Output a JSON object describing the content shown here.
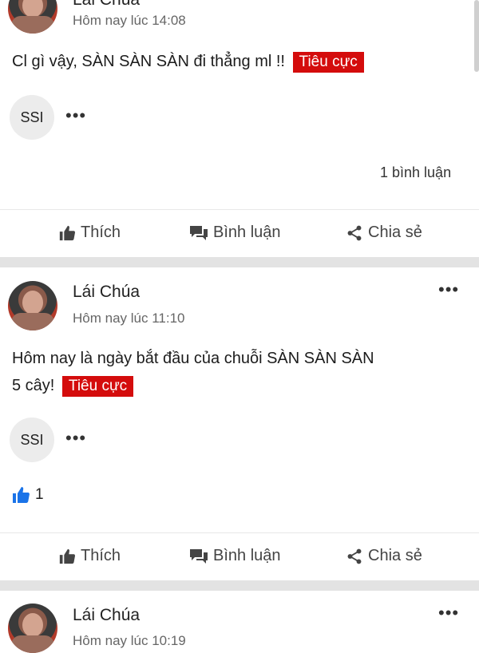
{
  "posts": [
    {
      "author": "Lái Chúa",
      "time": "Hôm nay lúc 14:08",
      "text": "Cl gì vậy, SÀN SÀN SÀN đi thẳng ml !!",
      "tag": "Tiêu cực",
      "chip": "SSI",
      "comment_count": "1 bình luận"
    },
    {
      "author": "Lái Chúa",
      "time": "Hôm nay lúc 11:10",
      "text_line1": "Hôm nay là ngày bắt đầu của chuỗi SÀN SÀN SÀN",
      "text_line2": "5 cây!",
      "tag": "Tiêu cực",
      "chip": "SSI",
      "like_count": "1"
    },
    {
      "author": "Lái Chúa",
      "time": "Hôm nay lúc 10:19"
    }
  ],
  "actions": {
    "like": "Thích",
    "comment": "Bình luận",
    "share": "Chia sẻ"
  },
  "icons": {
    "more": "more-horizontal-icon",
    "like": "thumbs-up-icon",
    "comment": "chat-bubbles-icon",
    "share": "share-icon"
  },
  "colors": {
    "tag_bg": "#d40c0c",
    "like_blue": "#1a73e8"
  }
}
